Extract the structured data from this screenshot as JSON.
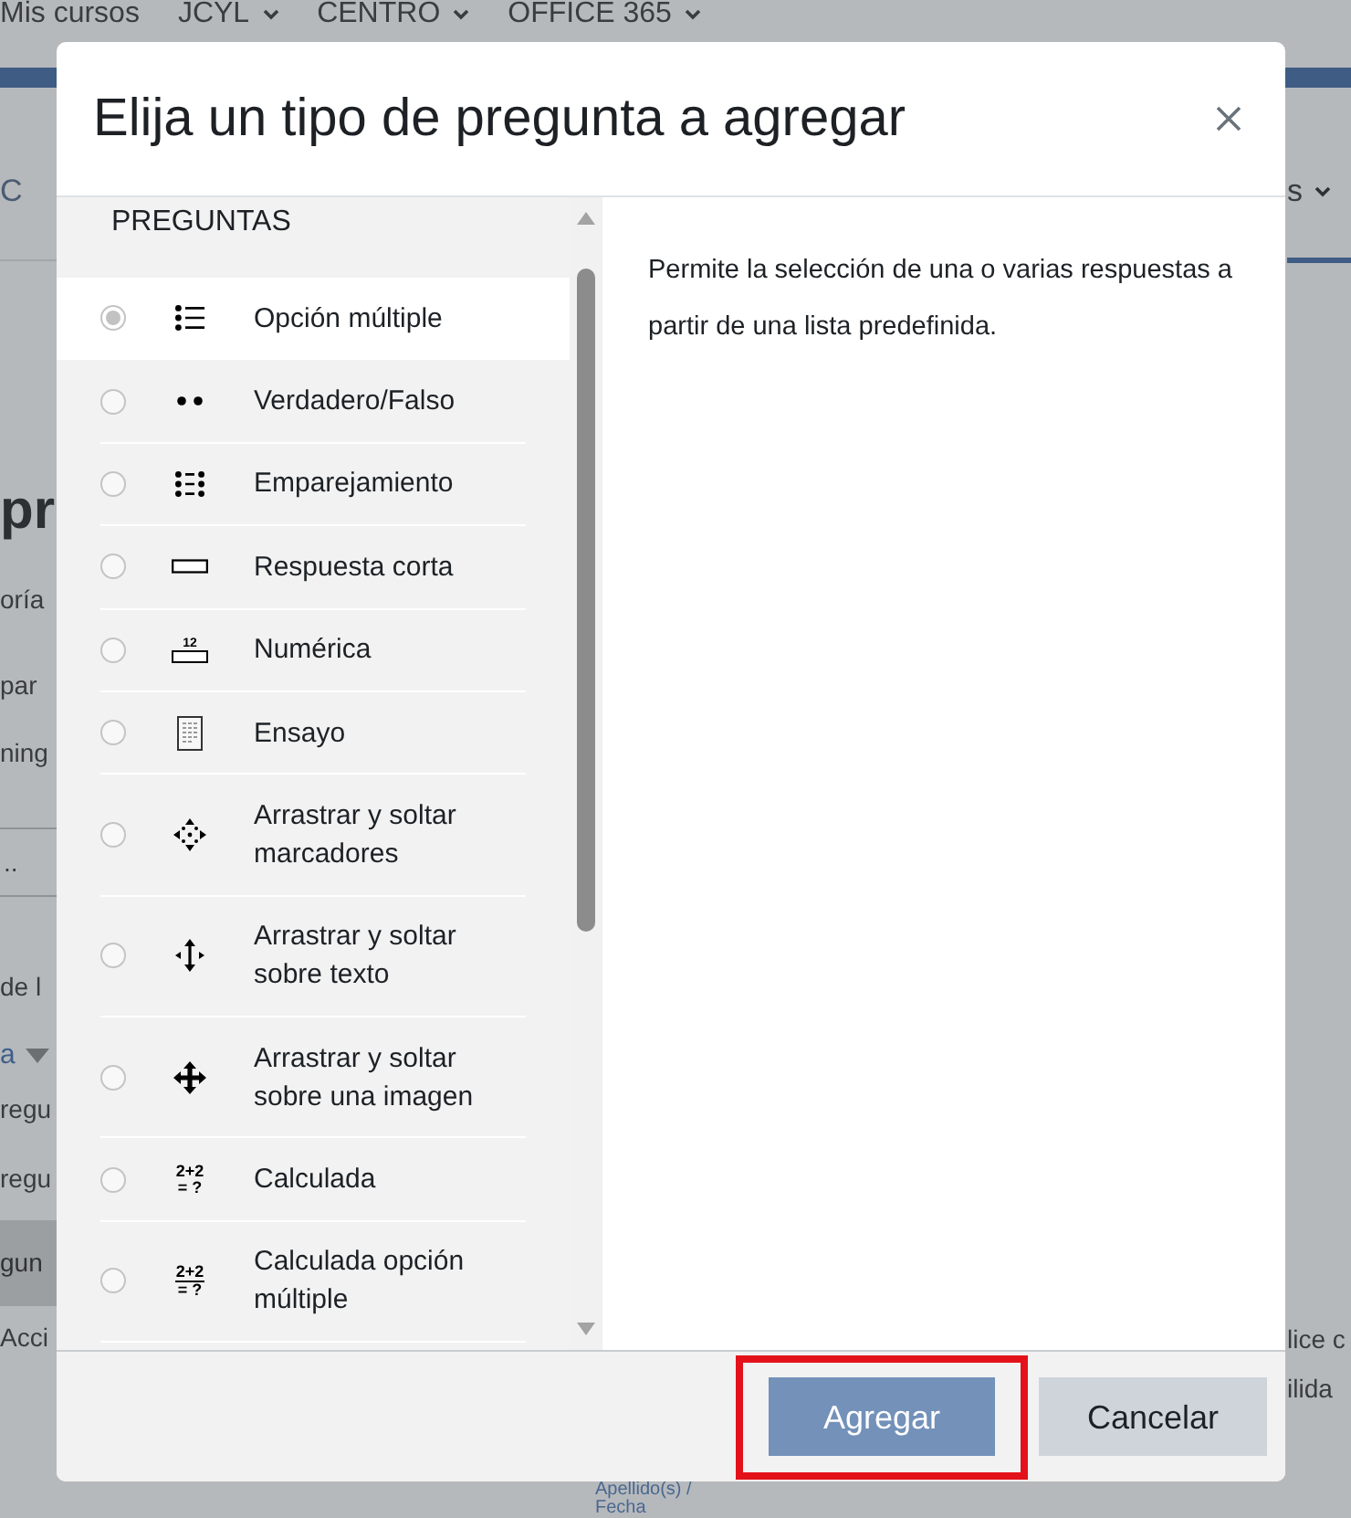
{
  "background_page": {
    "nav_items": [
      {
        "label": "Mis cursos",
        "has_menu": false
      },
      {
        "label": "JCYL",
        "has_menu": true
      },
      {
        "label": "CENTRO",
        "has_menu": true
      },
      {
        "label": "OFFICE 365",
        "has_menu": true
      }
    ],
    "left_fragments": [
      {
        "text": "C",
        "kind": "tab"
      },
      {
        "text": "pr",
        "kind": "heading"
      },
      {
        "text": "oría",
        "kind": "text"
      },
      {
        "text": "par",
        "kind": "text"
      },
      {
        "text": "ning",
        "kind": "text"
      },
      {
        "text": "..",
        "kind": "field"
      },
      {
        "text": "de l",
        "kind": "text"
      },
      {
        "text": "a",
        "kind": "dropdown"
      },
      {
        "text": "regu",
        "kind": "text"
      },
      {
        "text": "regu",
        "kind": "text"
      },
      {
        "text": "gun",
        "kind": "highlighted"
      },
      {
        "text": "Acci",
        "kind": "text"
      }
    ],
    "right_fragments": [
      {
        "text": "s",
        "kind": "tabmenu"
      },
      {
        "text": "lice c",
        "kind": "text"
      },
      {
        "text": "ilida",
        "kind": "text"
      }
    ],
    "bottom_links": [
      "Apellido(s) /",
      "Fecha"
    ]
  },
  "dialog": {
    "title": "Elija un tipo de pregunta a agregar",
    "section_heading": "PREGUNTAS",
    "question_types": [
      {
        "label": "Opción múltiple",
        "kind": "list",
        "selected": true
      },
      {
        "label": "Verdadero/Falso",
        "kind": "dots",
        "selected": false
      },
      {
        "label": "Emparejamiento",
        "kind": "pairs",
        "selected": false
      },
      {
        "label": "Respuesta corta",
        "kind": "textbox",
        "selected": false
      },
      {
        "label": "Numérica",
        "kind": "number",
        "icon_lines": [
          "12"
        ],
        "selected": false
      },
      {
        "label": "Ensayo",
        "kind": "document",
        "selected": false
      },
      {
        "label": "Arrastrar y soltar marcadores",
        "kind": "markers",
        "selected": false
      },
      {
        "label": "Arrastrar y soltar sobre texto",
        "kind": "textdrag",
        "selected": false
      },
      {
        "label": "Arrastrar y soltar sobre una imagen",
        "kind": "move",
        "selected": false
      },
      {
        "label": "Calculada",
        "kind": "formula",
        "icon_lines": [
          "2+2",
          "= ?"
        ],
        "selected": false
      },
      {
        "label": "Calculada opción múltiple",
        "kind": "fraction",
        "icon_lines": [
          "2+2",
          "= ?"
        ],
        "selected": false
      }
    ],
    "description": "Permite la selección de una o varias respuestas a partir de una lista predefinida.",
    "buttons": [
      {
        "label": "Agregar",
        "kind": "primary",
        "highlighted": true
      },
      {
        "label": "Cancelar",
        "kind": "secondary",
        "highlighted": false
      }
    ]
  }
}
